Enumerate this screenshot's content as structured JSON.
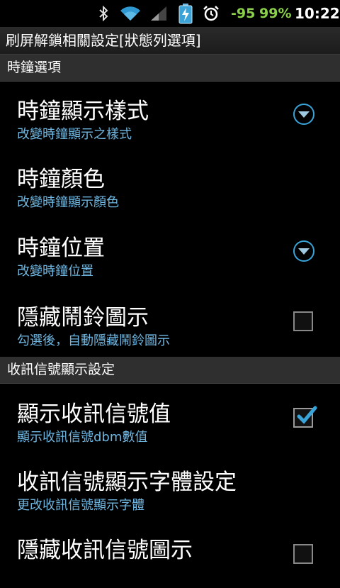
{
  "status_bar": {
    "signal_value": "-95",
    "battery_percent": "99%",
    "time": "10:22",
    "icons": [
      "bluetooth-icon",
      "wifi-icon",
      "cell-signal-icon",
      "battery-charging-icon",
      "alarm-icon"
    ]
  },
  "title": "刷屏解鎖相關設定[狀態列選項]",
  "sections": [
    {
      "label": "時鐘選項"
    },
    {
      "label": "收訊信號顯示設定"
    }
  ],
  "rows": [
    {
      "title": "時鐘顯示樣式",
      "summary": "改變時鐘顯示之樣式",
      "widget": "dropdown"
    },
    {
      "title": "時鐘顏色",
      "summary": "改變時鐘顯示顏色",
      "widget": "none"
    },
    {
      "title": "時鐘位置",
      "summary": "改變時鐘位置",
      "widget": "dropdown"
    },
    {
      "title": "隱藏鬧鈴圖示",
      "summary": "勾選後，自動隱藏鬧鈴圖示",
      "widget": "checkbox",
      "checked": false
    },
    {
      "title": "顯示收訊信號值",
      "summary": "顯示收訊信號dbm數值",
      "widget": "checkbox",
      "checked": true
    },
    {
      "title": "收訊信號顯示字體設定",
      "summary": "更改收訊信號顯示字體",
      "widget": "none"
    },
    {
      "title": "隱藏收訊信號圖示",
      "summary": "",
      "widget": "checkbox",
      "checked": false
    }
  ],
  "colors": {
    "accent": "#3aa3d8",
    "summary_text": "#6fb6e0",
    "status_green": "#8bd04a"
  }
}
